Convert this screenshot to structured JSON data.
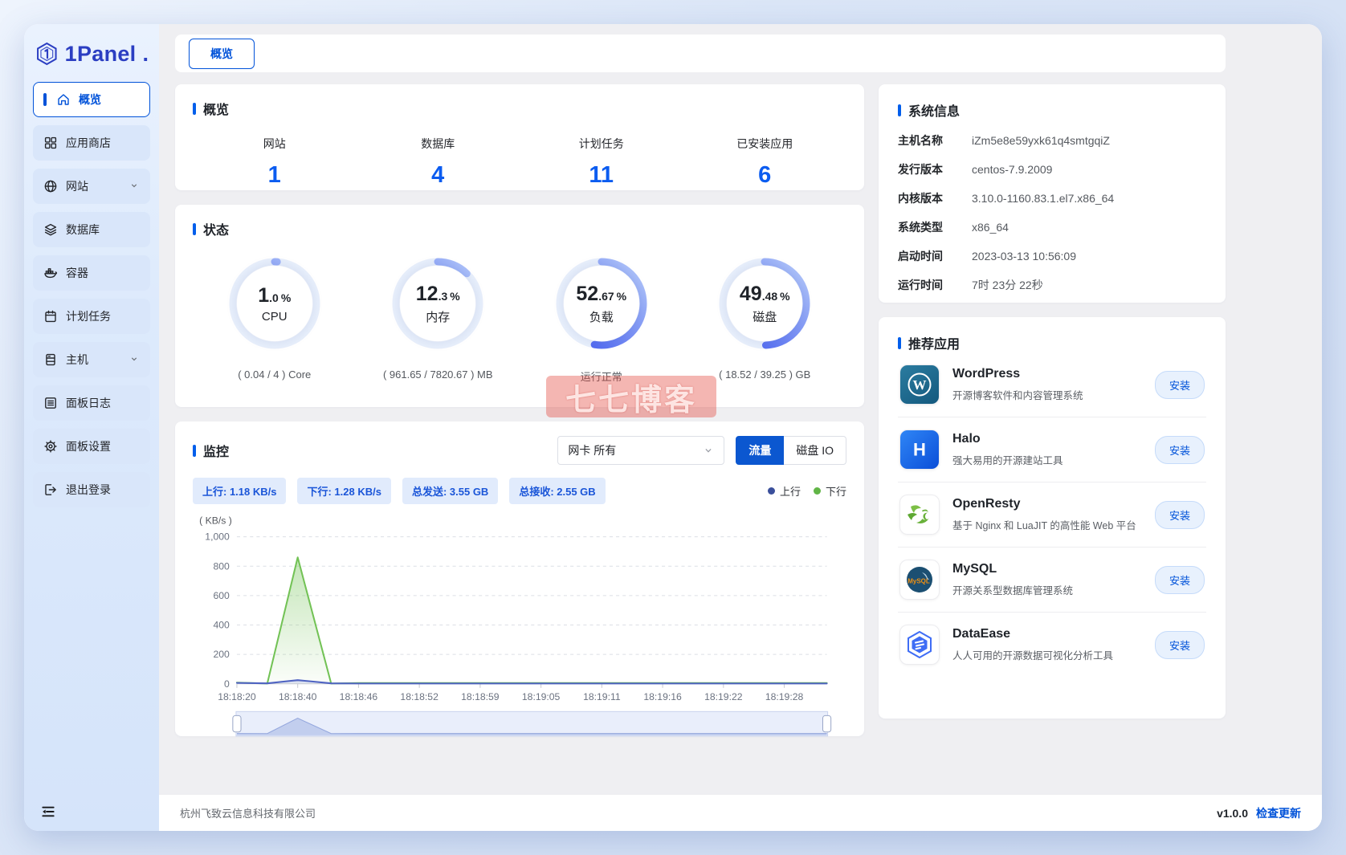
{
  "app": {
    "brand": "1Panel",
    "brand_suffix": ".",
    "tab": "概览"
  },
  "sidebar": {
    "items": [
      {
        "label": "概览",
        "icon": "home-icon",
        "active": true
      },
      {
        "label": "应用商店",
        "icon": "appstore-icon"
      },
      {
        "label": "网站",
        "icon": "globe-icon",
        "chevron": true
      },
      {
        "label": "数据库",
        "icon": "database-icon"
      },
      {
        "label": "容器",
        "icon": "container-icon"
      },
      {
        "label": "计划任务",
        "icon": "calendar-icon"
      },
      {
        "label": "主机",
        "icon": "host-icon",
        "chevron": true
      },
      {
        "label": "面板日志",
        "icon": "log-icon"
      },
      {
        "label": "面板设置",
        "icon": "settings-icon"
      },
      {
        "label": "退出登录",
        "icon": "logout-icon"
      }
    ]
  },
  "overview": {
    "title": "概览",
    "stats": [
      {
        "label": "网站",
        "value": "1"
      },
      {
        "label": "数据库",
        "value": "4"
      },
      {
        "label": "计划任务",
        "value": "11"
      },
      {
        "label": "已安装应用",
        "value": "6"
      }
    ]
  },
  "status": {
    "title": "状态",
    "gauges": [
      {
        "int": "1",
        "frac": ".0",
        "unit": "%",
        "percent": 1.0,
        "label": "CPU",
        "detail": "( 0.04 / 4 ) Core"
      },
      {
        "int": "12",
        "frac": ".3",
        "unit": "%",
        "percent": 12.3,
        "label": "内存",
        "detail": "( 961.65 / 7820.67 ) MB"
      },
      {
        "int": "52",
        "frac": ".67",
        "unit": "%",
        "percent": 52.67,
        "label": "负载",
        "detail": "运行正常"
      },
      {
        "int": "49",
        "frac": ".48",
        "unit": "%",
        "percent": 49.48,
        "label": "磁盘",
        "detail": "( 18.52 / 39.25 ) GB"
      }
    ]
  },
  "monitor": {
    "title": "监控",
    "nic_select": "网卡 所有",
    "traffic_btn": "流量",
    "disk_btn": "磁盘 IO",
    "tags": [
      "上行: 1.18 KB/s",
      "下行: 1.28 KB/s",
      "总发送: 3.55 GB",
      "总接收: 2.55 GB"
    ],
    "legend": [
      {
        "name": "上行",
        "color": "#3a4f9b"
      },
      {
        "name": "下行",
        "color": "#61b546"
      }
    ]
  },
  "chart_data": {
    "type": "area",
    "title": "网络流量监控(流量)",
    "ylabel": "( KB/s )",
    "ylim": [
      0,
      1000
    ],
    "yticks": [
      0,
      200,
      400,
      600,
      800,
      1000
    ],
    "x_ticks": [
      "18:18:20",
      "18:18:40",
      "18:18:46",
      "18:18:52",
      "18:18:59",
      "18:19:05",
      "18:19:11",
      "18:19:16",
      "18:19:22",
      "18:19:28"
    ],
    "x_unit": "tick-index (fractional positions between labeled ticks)",
    "grid": "horizontal-dashed",
    "legend_position": "top-right",
    "datazoom_slider": true,
    "series": [
      {
        "name": "上行",
        "color": "#4f63c2",
        "points": [
          [
            0,
            6
          ],
          [
            0.5,
            3
          ],
          [
            1,
            25
          ],
          [
            1.55,
            3
          ],
          [
            2,
            2
          ],
          [
            3,
            2
          ],
          [
            4,
            2
          ],
          [
            5,
            2
          ],
          [
            6,
            2
          ],
          [
            7,
            2
          ],
          [
            8,
            2
          ],
          [
            9,
            2
          ],
          [
            9.7,
            2
          ]
        ]
      },
      {
        "name": "下行",
        "color": "#72c255",
        "points": [
          [
            0,
            8
          ],
          [
            0.5,
            2
          ],
          [
            1,
            860
          ],
          [
            1.55,
            2
          ],
          [
            2,
            5
          ],
          [
            3,
            5
          ],
          [
            4,
            5
          ],
          [
            5,
            5
          ],
          [
            6,
            5
          ],
          [
            7,
            5
          ],
          [
            8,
            5
          ],
          [
            9,
            5
          ],
          [
            9.7,
            5
          ]
        ]
      }
    ]
  },
  "system_info": {
    "title": "系统信息",
    "rows": [
      {
        "label": "主机名称",
        "value": "iZm5e8e59yxk61q4smtgqiZ"
      },
      {
        "label": "发行版本",
        "value": "centos-7.9.2009"
      },
      {
        "label": "内核版本",
        "value": "3.10.0-1160.83.1.el7.x86_64"
      },
      {
        "label": "系统类型",
        "value": "x86_64"
      },
      {
        "label": "启动时间",
        "value": "2023-03-13 10:56:09"
      },
      {
        "label": "运行时间",
        "value": "7时 23分 22秒"
      }
    ]
  },
  "apps": {
    "title": "推荐应用",
    "install_label": "安装",
    "items": [
      {
        "name": "WordPress",
        "desc": "开源博客软件和内容管理系统",
        "icon": "wordpress-icon",
        "icon_letter": "W"
      },
      {
        "name": "Halo",
        "desc": "强大易用的开源建站工具",
        "icon": "halo-icon",
        "icon_letter": "H"
      },
      {
        "name": "OpenResty",
        "desc": "基于 Nginx 和 LuaJIT 的高性能 Web 平台",
        "icon": "openresty-icon"
      },
      {
        "name": "MySQL",
        "desc": "开源关系型数据库管理系统",
        "icon": "mysql-icon",
        "icon_text": "MySQL"
      },
      {
        "name": "DataEase",
        "desc": "人人可用的开源数据可视化分析工具",
        "icon": "dataease-icon"
      }
    ]
  },
  "footer": {
    "company": "杭州飞致云信息科技有限公司",
    "version": "v1.0.0",
    "check_update": "检查更新"
  },
  "watermark": {
    "text": "七七博客"
  },
  "colors": {
    "primary": "#0052d9",
    "section_bar": "#005eeb",
    "stat_value": "#0b5cf0",
    "gauge_track": "#e8effb",
    "gauge_start": "#3c55ee",
    "gauge_end": "#b9cdfa",
    "up_line": "#4f63c2",
    "down_line": "#72c255"
  }
}
